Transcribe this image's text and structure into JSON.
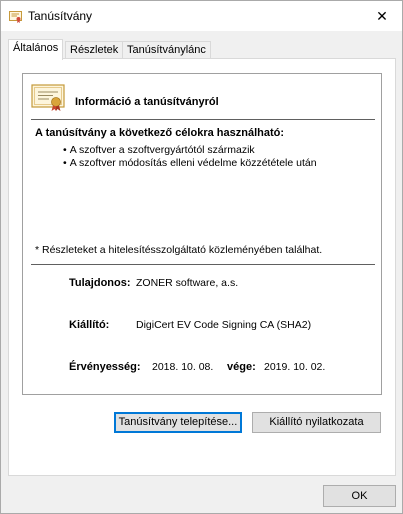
{
  "window": {
    "title": "Tanúsítvány",
    "close_label": "✕"
  },
  "tabs": [
    {
      "label": "Általános"
    },
    {
      "label": "Részletek"
    },
    {
      "label": "Tanúsítványlánc"
    }
  ],
  "info": {
    "title": "Információ a tanúsítványról",
    "purposes_heading": "A tanúsítvány a következő célokra használható:",
    "purposes": [
      "A szoftver a szoftvergyártótól származik",
      "A szoftver módosítás elleni védelme közzététele után"
    ],
    "note": "* Részleteket a hitelesítésszolgáltató közleményében találhat.",
    "issued_to_label": "Tulajdonos:",
    "issued_to_value": "ZONER software, a.s.",
    "issued_by_label": "Kiállító:",
    "issued_by_value": "DigiCert EV Code Signing CA (SHA2)",
    "valid_label": "Érvényesség:",
    "valid_from": "2018. 10. 08.",
    "valid_to_label": "vége:",
    "valid_to": "2019. 10. 02."
  },
  "buttons": {
    "install": "Tanúsítvány telepítése...",
    "issuer_statement": "Kiállító nyilatkozata",
    "ok": "OK"
  },
  "icons": {
    "title_icon": "certificate-icon",
    "info_icon": "certificate-icon",
    "close_icon": "close-icon"
  },
  "colors": {
    "accent": "#0078d7",
    "button_bg": "#e1e1e1",
    "panel_bg": "#ffffff",
    "window_bg": "#f0f0f0"
  }
}
